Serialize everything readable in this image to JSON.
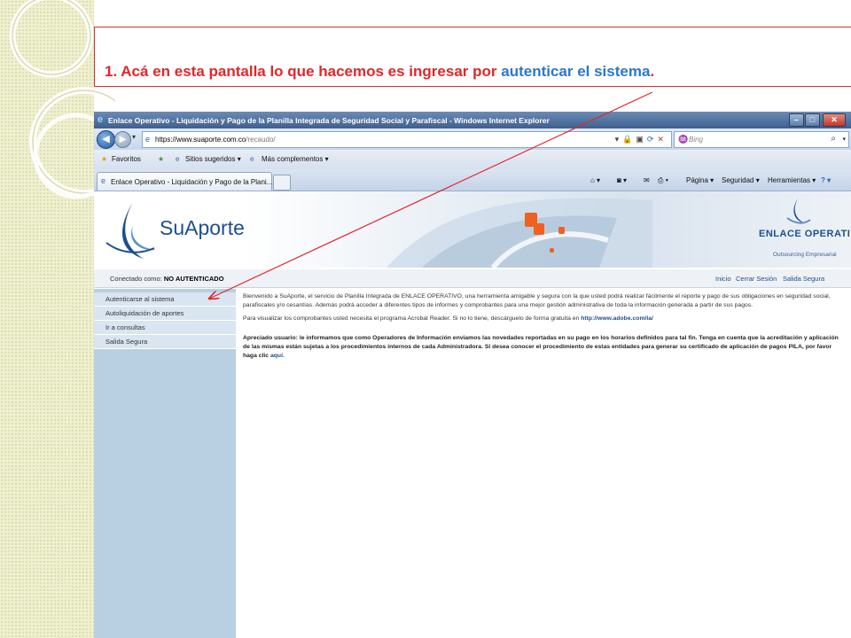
{
  "caption": {
    "number": "1.",
    "text_red": "Acá en esta pantalla lo que hacemos es ingresar por",
    "text_blue": "autenticar el sistema",
    "period": "."
  },
  "browser": {
    "window_title": "Enlace Operativo - Liquidación y Pago de la Planilla Integrada de Seguridad Social y Parafiscal - Windows Internet Explorer",
    "address_scheme": "https://",
    "address_host": "www.suaporte.com.co",
    "address_path": "/recaudo/",
    "search_placeholder": "Bing",
    "favorites": "Favoritos",
    "suggested_sites": "Sitios sugeridos ▾",
    "more_addons": "Más complementos ▾",
    "tab_title": "Enlace Operativo - Liquidación y Pago de la Plani...",
    "cmd_page": "Página ▾",
    "cmd_security": "Seguridad ▾",
    "cmd_tools": "Herramientas ▾"
  },
  "site": {
    "logo_text": "SuAporte",
    "brand_name": "ENLACE OPERATIVO",
    "brand_tagline": "Outsourcing Empresarial",
    "connected_label": "Conectado como:",
    "connected_value": "NO AUTENTICADO",
    "top_links": [
      "Inicio",
      "Cerrar Sesión",
      "Salida Segura"
    ],
    "menu": [
      "Autenticarse al sistema",
      "Autoliquidación de aportes",
      "Ir a consultas",
      "Salida Segura"
    ],
    "welcome_text": "Bienvenido a SuAporte, el servicio de Planilla Integrada de ENLACE OPERATIVO, una herramienta amigable y segura con la que usted podrá realizar fácilmente el reporte y pago de sus obligaciones en seguridad social, parafiscales y/o cesantías. Además podrá acceder a diferentes tipos de informes y comprobantes para una mejor gestión administrativa de toda la información generada a partir de sus pagos.",
    "reader_text": "Para visualizar los comprobantes usted necesita el programa Acrobat Reader. Si no lo tiene, descárguelo de forma gratuita en",
    "reader_link": "http://www.adobe.com/la/",
    "notice_text": "Apreciado usuario: le informamos que como Operadores de Información enviamos las novedades reportadas en su pago en los horarios definidos para tal fin. Tenga en cuenta que la acreditación y aplicación de las mismas están sujetas a los procedimientos internos de cada Administradora. Si desea conocer el procedimiento de estas entidades para generar su certificado de aplicación de pagos PILA, por favor haga clic",
    "notice_link": "aquí."
  },
  "colors": {
    "caption_red": "#e0282a",
    "caption_blue": "#2c78c8",
    "sidebar": "#b9cfe2",
    "brand_blue": "#1d4f8f"
  }
}
